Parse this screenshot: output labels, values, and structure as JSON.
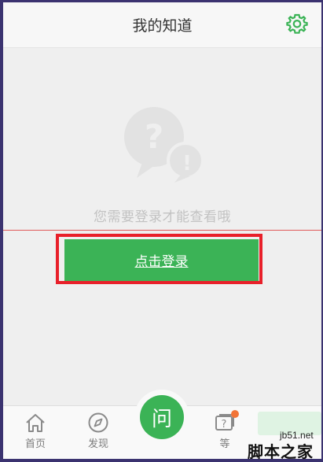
{
  "header": {
    "title": "我的知道"
  },
  "empty_state": {
    "message": "您需要登录才能查看哦"
  },
  "login": {
    "label": "点击登录"
  },
  "tabbar": {
    "items": [
      {
        "label": "首页",
        "icon": "home-icon"
      },
      {
        "label": "发现",
        "icon": "compass-icon"
      },
      {
        "label": "问",
        "icon": "ask-icon"
      },
      {
        "label": "等",
        "icon": "question-card-icon"
      }
    ]
  },
  "watermark": {
    "site": "jb51.net",
    "name": "脚本之家"
  },
  "colors": {
    "accent": "#3bb356",
    "highlight": "#e8202a",
    "notify": "#f27437"
  }
}
